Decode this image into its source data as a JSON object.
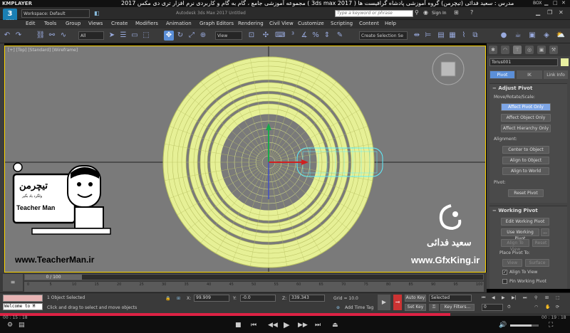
{
  "player": {
    "title": "KMPLAYER",
    "box_label": "BOX",
    "elapsed": "00 : 15 : 18",
    "total": "00 : 19 : 18",
    "progress": 0.79
  },
  "course_title": "مجموعه آموزشی جامع ، گام به گام و کاربردی نرم افزار تری دی مکس 2017 ( 3ds max 2017 ) مدرس : سعید فدائی (تیچرمن) گروه آموزشی پادشاه گرافیست ها",
  "app": {
    "logo": "3",
    "logo_sub": "MAX",
    "workspace": "Workspace: Default",
    "window_title": "Autodesk 3ds Max 2017    Untitled",
    "search_placeholder": "Type a keyword or phrase",
    "sign_in": "Sign In"
  },
  "menu": [
    "Edit",
    "Tools",
    "Group",
    "Views",
    "Create",
    "Modifiers",
    "Animation",
    "Graph Editors",
    "Rendering",
    "Civil View",
    "Customize",
    "Scripting",
    "Content",
    "Help"
  ],
  "toolbar": {
    "filter_value": "All",
    "refcoord_value": "View",
    "selection_set_placeholder": "Create Selection Se"
  },
  "viewport": {
    "label": "[+] [Top] [Standard] [Wireframe]"
  },
  "command_panel": {
    "object_name": "Torus001",
    "tabs": [
      "Pivot",
      "IK",
      "Link Info"
    ],
    "adjust_pivot": {
      "header": "Adjust Pivot",
      "move_label": "Move/Rotate/Scale:",
      "buttons": [
        "Affect Pivot Only",
        "Affect Object Only",
        "Affect Hierarchy Only"
      ],
      "alignment_label": "Alignment:",
      "align_buttons": [
        "Center to Object",
        "Align to Object",
        "Align to World"
      ],
      "pivot_label": "Pivot:",
      "reset_button": "Reset Pivot"
    },
    "working_pivot": {
      "header": "Working Pivot",
      "edit_button": "Edit Working Pivot",
      "use_button": "Use Working Pivot",
      "use_ellipsis": "...",
      "align_view": "Align To View",
      "reset": "Reset",
      "place_label": "Place Pivot To:",
      "view_btn": "View",
      "surface_btn": "Surface",
      "align_to_view_check": "Align To View",
      "pin_check": "Pin Working Pivot"
    }
  },
  "timeline": {
    "frame_display": "0 / 100",
    "ticks": [
      "0",
      "5",
      "10",
      "15",
      "20",
      "25",
      "30",
      "35",
      "40",
      "45",
      "50",
      "55",
      "60",
      "65",
      "70",
      "75",
      "80",
      "85",
      "90",
      "95",
      "100"
    ]
  },
  "status": {
    "maxscript": "Welcome to M",
    "selection": "1 Object Selected",
    "prompt": "Click and drag to select and move objects",
    "x_label": "X:",
    "x_value": "99.909",
    "y_label": "Y:",
    "y_value": "-0.0",
    "z_label": "Z:",
    "z_value": "339.343",
    "grid": "Grid = 10.0",
    "add_time_tag": "Add Time Tag",
    "auto_key": "Auto Key",
    "selected": "Selected",
    "set_key": "Set Key",
    "key_filters": "Key Filters...",
    "frame": "0"
  },
  "watermark": {
    "brand_fa": "تیچرمن",
    "tagline_fa": "ولگرد یاد بگیر",
    "brand_en": "Teacher Man",
    "url_left": "www.TeacherMan.ir",
    "instructor_fa": "سعید فدائی",
    "url_right": "www.GfxKing.ir"
  },
  "colors": {
    "torus": "#e6f096",
    "torus_wire": "#bcc46a",
    "selected_cyan": "#5ef0ff",
    "pivot_blue": "#5b8fd8",
    "viewport_bg": "#7a7a7a",
    "viewport_border": "#ffd700"
  }
}
